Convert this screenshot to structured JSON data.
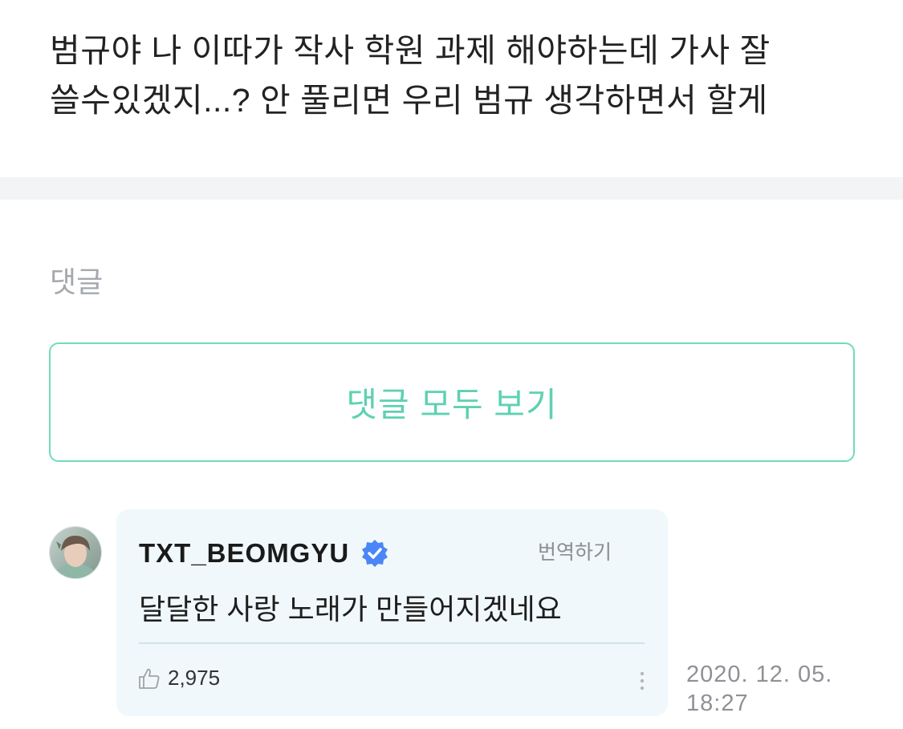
{
  "post": {
    "text_line1": "범규야 나 이따가 작사 학원 과제 해야하는데 가사 잘",
    "text_line2": "쓸수있겠지...? 안 풀리면 우리 범규 생각하면서 할게"
  },
  "comments": {
    "section_label": "댓글",
    "view_all_label": "댓글 모두 보기",
    "items": [
      {
        "author": "TXT_BEOMGYU",
        "verified": true,
        "translate_label": "번역하기",
        "body": "달달한 사랑 노래가 만들어지겠네요",
        "likes": "2,975",
        "date": "2020. 12. 05.",
        "time": "18:27",
        "icons": [
          "avatar",
          "verified-badge-icon",
          "thumbs-up-icon",
          "more-vertical-icon"
        ]
      }
    ]
  },
  "colors": {
    "accent": "#5ed1b2",
    "accent_border": "#6fdcbe",
    "card_bg": "#f0f8fb",
    "verified_blue": "#4a86f7",
    "muted_text": "#a5a8ad"
  }
}
